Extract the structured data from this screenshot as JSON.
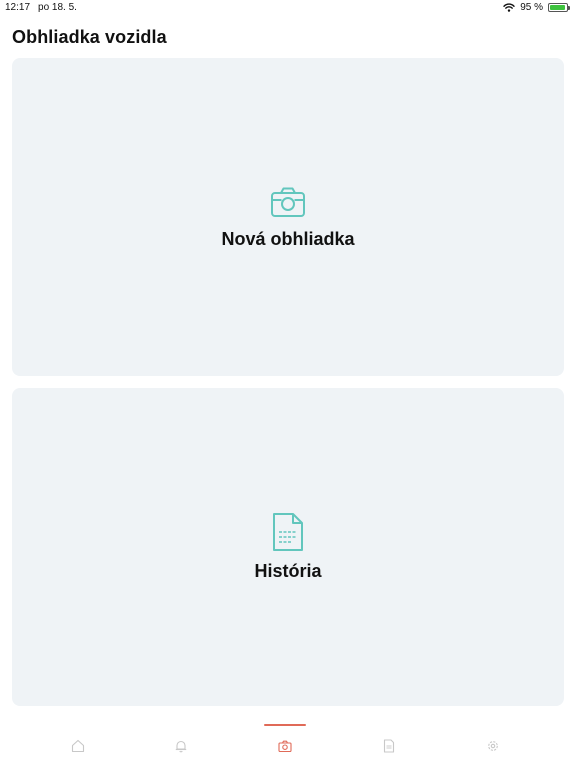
{
  "status_bar": {
    "time": "12:17",
    "date": "po 18. 5.",
    "battery_text": "95 %",
    "battery_level": 0.95
  },
  "header": {
    "title": "Obhliadka vozidla"
  },
  "cards": {
    "new_inspection": {
      "label": "Nová obhliadka",
      "icon": "camera-icon"
    },
    "history": {
      "label": "História",
      "icon": "document-icon"
    }
  },
  "tab_bar": {
    "tabs": [
      {
        "icon": "home-icon",
        "active": false
      },
      {
        "icon": "bell-icon",
        "active": false
      },
      {
        "icon": "camera-icon",
        "active": true
      },
      {
        "icon": "document-icon",
        "active": false
      },
      {
        "icon": "gear-icon",
        "active": false
      }
    ]
  },
  "colors": {
    "accent": "#e06a58",
    "icon_teal": "#62c6bd",
    "card_background": "#eff3f6",
    "inactive_icon": "#c8c8c8"
  }
}
